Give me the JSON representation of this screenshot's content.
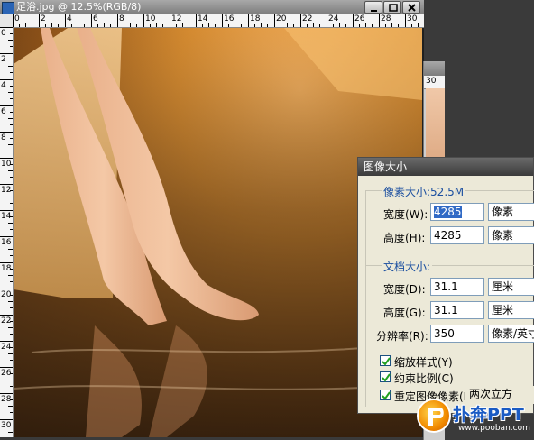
{
  "main_window": {
    "title": "足浴.jpg @ 12.5%(RGB/8)",
    "ruler_top_labels": [
      "0",
      "2",
      "4",
      "6",
      "8",
      "10",
      "12",
      "14",
      "16",
      "18",
      "20",
      "22",
      "24",
      "26",
      "28",
      "30"
    ],
    "ruler_left_labels": [
      "0",
      "2",
      "4",
      "6",
      "8",
      "10",
      "12",
      "14",
      "16",
      "18",
      "20",
      "22",
      "24",
      "26",
      "28",
      "30"
    ]
  },
  "second_window": {
    "ruler_label": "30"
  },
  "dialog": {
    "title": "图像大小",
    "pixel_dimensions": {
      "label": "像素大小:52.5M",
      "width_label": "宽度(W):",
      "width_value": "4285",
      "width_unit": "像素",
      "height_label": "高度(H):",
      "height_value": "4285",
      "height_unit": "像素"
    },
    "document_size": {
      "label": "文档大小:",
      "width_label": "宽度(D):",
      "width_value": "31.1",
      "width_unit": "厘米",
      "height_label": "高度(G):",
      "height_value": "31.1",
      "height_unit": "厘米",
      "resolution_label": "分辨率(R):",
      "resolution_value": "350",
      "resolution_unit": "像素/英寸"
    },
    "scale_styles_label": "缩放样式(Y)",
    "constrain_proportions_label": "约束比例(C)",
    "resample_label": "重定图像像素(I):",
    "resample_method": "两次立方"
  },
  "watermark": {
    "brand": "扑奔PPT",
    "url": "www.pooban.com"
  }
}
